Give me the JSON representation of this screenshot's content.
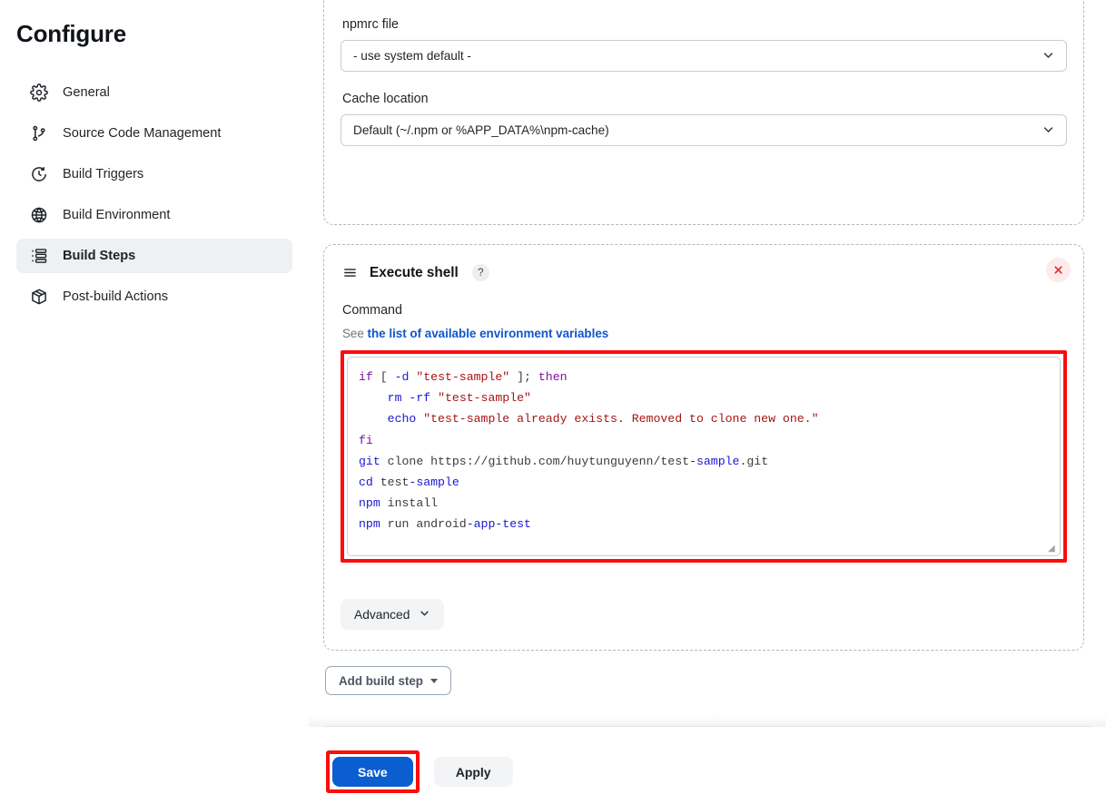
{
  "sidebar": {
    "title": "Configure",
    "items": [
      {
        "label": "General",
        "icon": "gear-icon",
        "active": false
      },
      {
        "label": "Source Code Management",
        "icon": "git-branch-icon",
        "active": false
      },
      {
        "label": "Build Triggers",
        "icon": "clock-icon",
        "active": false
      },
      {
        "label": "Build Environment",
        "icon": "globe-icon",
        "active": false
      },
      {
        "label": "Build Steps",
        "icon": "list-steps-icon",
        "active": true
      },
      {
        "label": "Post-build Actions",
        "icon": "package-icon",
        "active": false
      }
    ]
  },
  "npm_panel": {
    "npmrc_label": "npmrc file",
    "npmrc_value": "- use system default -",
    "cache_label": "Cache location",
    "cache_value": "Default (~/.npm or %APP_DATA%\\npm-cache)"
  },
  "shell_step": {
    "title": "Execute shell",
    "help_badge": "?",
    "drag_icon": "drag-handle-icon",
    "close_icon": "close-icon",
    "command_label": "Command",
    "env_prefix": "See ",
    "env_link": "the list of available environment variables",
    "script_lines": [
      "if [ -d \"test-sample\" ]; then",
      "    rm -rf \"test-sample\"",
      "    echo \"test-sample already exists. Removed to clone new one.\"",
      "fi",
      "git clone https://github.com/huytunguyenn/test-sample.git",
      "cd test-sample",
      "npm install",
      "npm run android-app-test"
    ],
    "advanced_label": "Advanced"
  },
  "actions": {
    "add_build_step": "Add build step",
    "save": "Save",
    "apply": "Apply"
  },
  "colors": {
    "accent_blue": "#0b5ed0",
    "link_blue": "#1155cc",
    "highlight_red": "#fb0d0d",
    "active_nav_bg": "#eef0f3",
    "panel_dashed": "#aeb8c2"
  }
}
